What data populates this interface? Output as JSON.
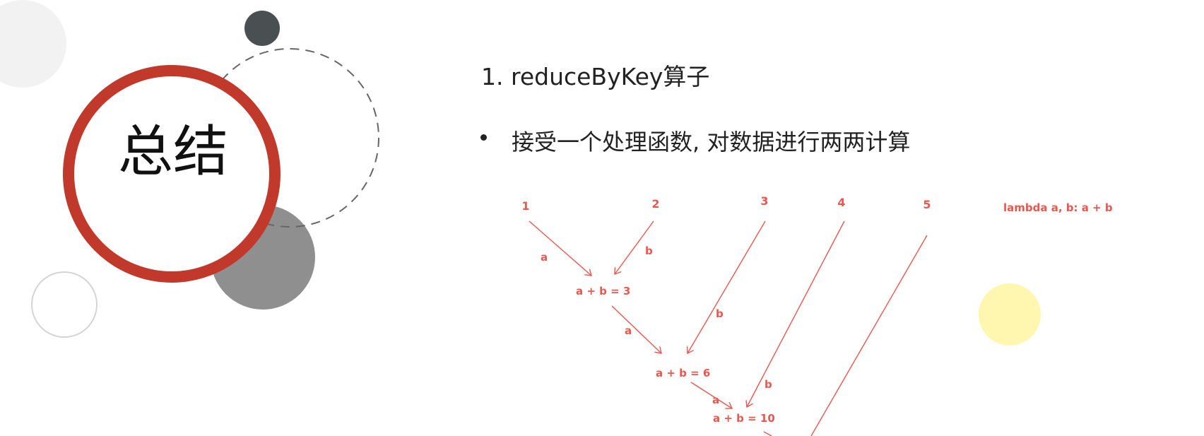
{
  "slide": {
    "title": "总结",
    "heading": "1. reduceByKey算子",
    "bullet": "接受一个处理函数, 对数据进行两两计算"
  },
  "diagram": {
    "numbers": [
      "1",
      "2",
      "3",
      "4",
      "5"
    ],
    "function_label": "lambda a, b: a + b",
    "results": [
      "a + b = 3",
      "a + b = 6",
      "a + b = 10"
    ],
    "edge_a": "a",
    "edge_b": "b"
  },
  "colors": {
    "ring": "#c0392b",
    "diagram": "#e8584f",
    "dark_circle": "#4a4f52",
    "gray_circle": "#8f8f8f",
    "yellow_circle": "#fff7b0"
  }
}
